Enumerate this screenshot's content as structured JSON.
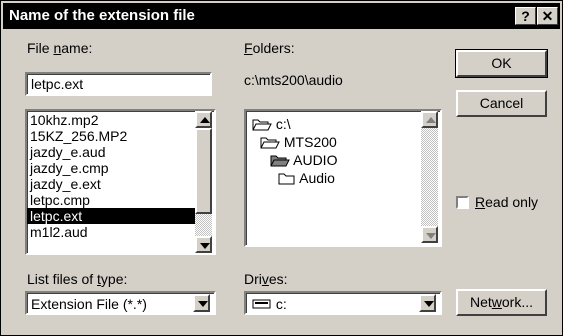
{
  "dialog": {
    "title": "Name of the extension file",
    "help_label": "?",
    "close_label": "✕"
  },
  "file_name": {
    "label_prefix": "File ",
    "label_hotkey": "n",
    "label_suffix": "ame:",
    "value": "letpc.ext"
  },
  "files": {
    "items": [
      "10khz.mp2",
      "15KZ_256.MP2",
      "jazdy_e.aud",
      "jazdy_e.cmp",
      "jazdy_e.ext",
      "letpc.cmp",
      "letpc.ext",
      "m1l2.aud"
    ],
    "selected": "letpc.ext"
  },
  "folders": {
    "label_hotkey": "F",
    "label_suffix": "olders:",
    "current_path": "c:\\mts200\\audio",
    "tree": [
      {
        "label": "c:\\",
        "icon": "open-folder-icon"
      },
      {
        "label": "MTS200",
        "icon": "open-folder-icon"
      },
      {
        "label": "AUDIO",
        "icon": "open-folder-selected-icon"
      },
      {
        "label": "Audio",
        "icon": "closed-folder-icon"
      }
    ]
  },
  "buttons": {
    "ok": "OK",
    "cancel": "Cancel",
    "network_prefix": "Net",
    "network_hotkey": "w",
    "network_suffix": "ork..."
  },
  "read_only": {
    "hotkey": "R",
    "suffix": "ead only",
    "checked": false
  },
  "file_type": {
    "label_prefix": "List files of ",
    "label_hotkey": "t",
    "label_suffix": "ype:",
    "value": "Extension File (*.*)"
  },
  "drives": {
    "label_prefix": "Dri",
    "label_hotkey": "v",
    "label_suffix": "es:",
    "value": "c:",
    "icon": "drive-icon"
  }
}
